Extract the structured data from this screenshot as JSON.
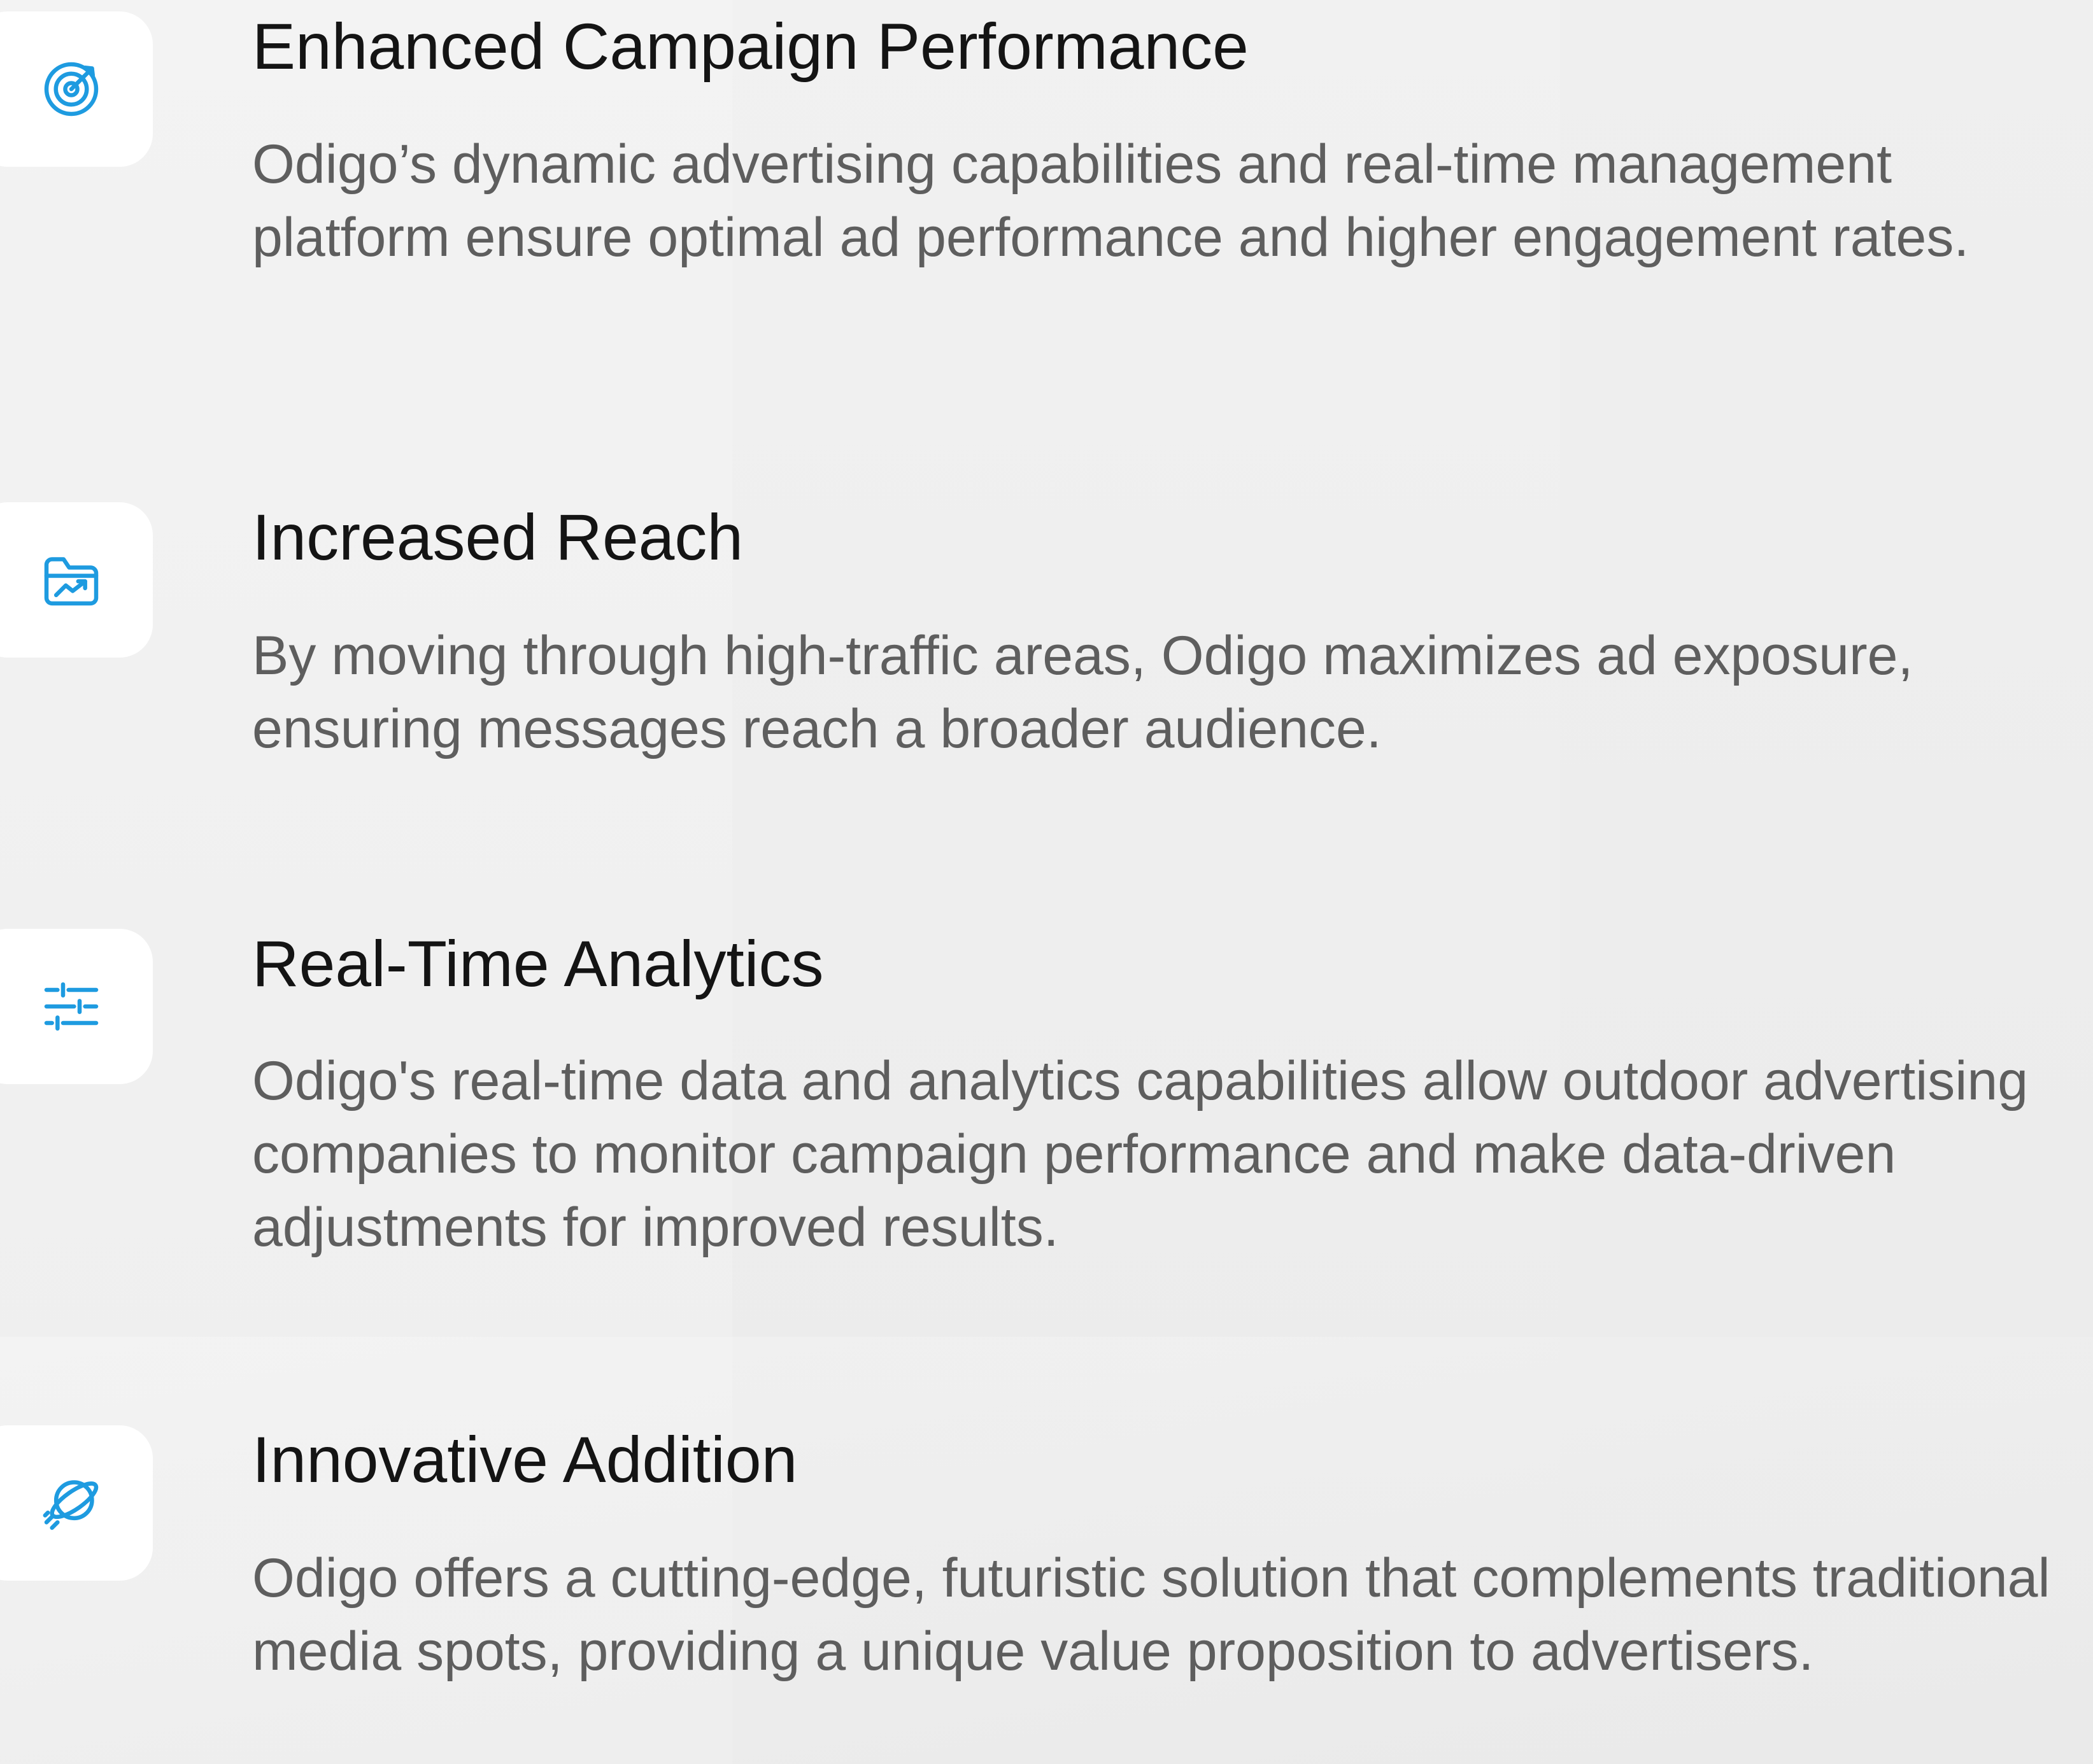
{
  "colors": {
    "background": "#efefef",
    "tile": "#ffffff",
    "icon_accent": "#1e9be0",
    "title_text": "#141414",
    "body_text": "#5e5e5e"
  },
  "features": [
    {
      "icon": "target-icon",
      "title": "Enhanced Campaign Performance",
      "description": "Odigo’s dynamic advertising capabilities and real-time management platform ensure optimal ad performance and higher engagement rates."
    },
    {
      "icon": "folder-chart-icon",
      "title": "Increased Reach",
      "description": "By moving through high-traffic areas, Odigo maximizes ad exposure, ensuring messages reach a broader audience."
    },
    {
      "icon": "sliders-icon",
      "title": "Real-Time Analytics",
      "description": "Odigo's real-time data and analytics capabilities allow outdoor advertising companies to monitor campaign performance and make data-driven adjustments for improved results."
    },
    {
      "icon": "planet-icon",
      "title": "Innovative Addition",
      "description": "Odigo offers a cutting-edge, futuristic solution that complements traditional media spots, providing a unique value proposition to advertisers."
    }
  ]
}
